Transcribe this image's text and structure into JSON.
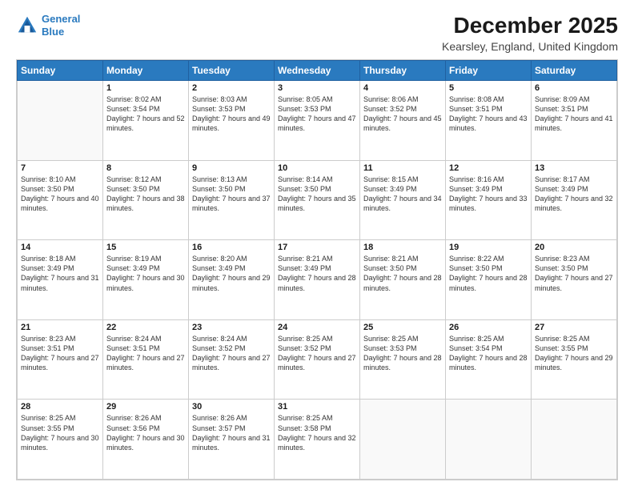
{
  "logo": {
    "line1": "General",
    "line2": "Blue"
  },
  "title": "December 2025",
  "subtitle": "Kearsley, England, United Kingdom",
  "days_of_week": [
    "Sunday",
    "Monday",
    "Tuesday",
    "Wednesday",
    "Thursday",
    "Friday",
    "Saturday"
  ],
  "weeks": [
    [
      {
        "num": "",
        "sunrise": "",
        "sunset": "",
        "daylight": "",
        "empty": true
      },
      {
        "num": "1",
        "sunrise": "Sunrise: 8:02 AM",
        "sunset": "Sunset: 3:54 PM",
        "daylight": "Daylight: 7 hours and 52 minutes."
      },
      {
        "num": "2",
        "sunrise": "Sunrise: 8:03 AM",
        "sunset": "Sunset: 3:53 PM",
        "daylight": "Daylight: 7 hours and 49 minutes."
      },
      {
        "num": "3",
        "sunrise": "Sunrise: 8:05 AM",
        "sunset": "Sunset: 3:53 PM",
        "daylight": "Daylight: 7 hours and 47 minutes."
      },
      {
        "num": "4",
        "sunrise": "Sunrise: 8:06 AM",
        "sunset": "Sunset: 3:52 PM",
        "daylight": "Daylight: 7 hours and 45 minutes."
      },
      {
        "num": "5",
        "sunrise": "Sunrise: 8:08 AM",
        "sunset": "Sunset: 3:51 PM",
        "daylight": "Daylight: 7 hours and 43 minutes."
      },
      {
        "num": "6",
        "sunrise": "Sunrise: 8:09 AM",
        "sunset": "Sunset: 3:51 PM",
        "daylight": "Daylight: 7 hours and 41 minutes."
      }
    ],
    [
      {
        "num": "7",
        "sunrise": "Sunrise: 8:10 AM",
        "sunset": "Sunset: 3:50 PM",
        "daylight": "Daylight: 7 hours and 40 minutes."
      },
      {
        "num": "8",
        "sunrise": "Sunrise: 8:12 AM",
        "sunset": "Sunset: 3:50 PM",
        "daylight": "Daylight: 7 hours and 38 minutes."
      },
      {
        "num": "9",
        "sunrise": "Sunrise: 8:13 AM",
        "sunset": "Sunset: 3:50 PM",
        "daylight": "Daylight: 7 hours and 37 minutes."
      },
      {
        "num": "10",
        "sunrise": "Sunrise: 8:14 AM",
        "sunset": "Sunset: 3:50 PM",
        "daylight": "Daylight: 7 hours and 35 minutes."
      },
      {
        "num": "11",
        "sunrise": "Sunrise: 8:15 AM",
        "sunset": "Sunset: 3:49 PM",
        "daylight": "Daylight: 7 hours and 34 minutes."
      },
      {
        "num": "12",
        "sunrise": "Sunrise: 8:16 AM",
        "sunset": "Sunset: 3:49 PM",
        "daylight": "Daylight: 7 hours and 33 minutes."
      },
      {
        "num": "13",
        "sunrise": "Sunrise: 8:17 AM",
        "sunset": "Sunset: 3:49 PM",
        "daylight": "Daylight: 7 hours and 32 minutes."
      }
    ],
    [
      {
        "num": "14",
        "sunrise": "Sunrise: 8:18 AM",
        "sunset": "Sunset: 3:49 PM",
        "daylight": "Daylight: 7 hours and 31 minutes."
      },
      {
        "num": "15",
        "sunrise": "Sunrise: 8:19 AM",
        "sunset": "Sunset: 3:49 PM",
        "daylight": "Daylight: 7 hours and 30 minutes."
      },
      {
        "num": "16",
        "sunrise": "Sunrise: 8:20 AM",
        "sunset": "Sunset: 3:49 PM",
        "daylight": "Daylight: 7 hours and 29 minutes."
      },
      {
        "num": "17",
        "sunrise": "Sunrise: 8:21 AM",
        "sunset": "Sunset: 3:49 PM",
        "daylight": "Daylight: 7 hours and 28 minutes."
      },
      {
        "num": "18",
        "sunrise": "Sunrise: 8:21 AM",
        "sunset": "Sunset: 3:50 PM",
        "daylight": "Daylight: 7 hours and 28 minutes."
      },
      {
        "num": "19",
        "sunrise": "Sunrise: 8:22 AM",
        "sunset": "Sunset: 3:50 PM",
        "daylight": "Daylight: 7 hours and 28 minutes."
      },
      {
        "num": "20",
        "sunrise": "Sunrise: 8:23 AM",
        "sunset": "Sunset: 3:50 PM",
        "daylight": "Daylight: 7 hours and 27 minutes."
      }
    ],
    [
      {
        "num": "21",
        "sunrise": "Sunrise: 8:23 AM",
        "sunset": "Sunset: 3:51 PM",
        "daylight": "Daylight: 7 hours and 27 minutes."
      },
      {
        "num": "22",
        "sunrise": "Sunrise: 8:24 AM",
        "sunset": "Sunset: 3:51 PM",
        "daylight": "Daylight: 7 hours and 27 minutes."
      },
      {
        "num": "23",
        "sunrise": "Sunrise: 8:24 AM",
        "sunset": "Sunset: 3:52 PM",
        "daylight": "Daylight: 7 hours and 27 minutes."
      },
      {
        "num": "24",
        "sunrise": "Sunrise: 8:25 AM",
        "sunset": "Sunset: 3:52 PM",
        "daylight": "Daylight: 7 hours and 27 minutes."
      },
      {
        "num": "25",
        "sunrise": "Sunrise: 8:25 AM",
        "sunset": "Sunset: 3:53 PM",
        "daylight": "Daylight: 7 hours and 28 minutes."
      },
      {
        "num": "26",
        "sunrise": "Sunrise: 8:25 AM",
        "sunset": "Sunset: 3:54 PM",
        "daylight": "Daylight: 7 hours and 28 minutes."
      },
      {
        "num": "27",
        "sunrise": "Sunrise: 8:25 AM",
        "sunset": "Sunset: 3:55 PM",
        "daylight": "Daylight: 7 hours and 29 minutes."
      }
    ],
    [
      {
        "num": "28",
        "sunrise": "Sunrise: 8:25 AM",
        "sunset": "Sunset: 3:55 PM",
        "daylight": "Daylight: 7 hours and 30 minutes."
      },
      {
        "num": "29",
        "sunrise": "Sunrise: 8:26 AM",
        "sunset": "Sunset: 3:56 PM",
        "daylight": "Daylight: 7 hours and 30 minutes."
      },
      {
        "num": "30",
        "sunrise": "Sunrise: 8:26 AM",
        "sunset": "Sunset: 3:57 PM",
        "daylight": "Daylight: 7 hours and 31 minutes."
      },
      {
        "num": "31",
        "sunrise": "Sunrise: 8:25 AM",
        "sunset": "Sunset: 3:58 PM",
        "daylight": "Daylight: 7 hours and 32 minutes."
      },
      {
        "num": "",
        "sunrise": "",
        "sunset": "",
        "daylight": "",
        "empty": true
      },
      {
        "num": "",
        "sunrise": "",
        "sunset": "",
        "daylight": "",
        "empty": true
      },
      {
        "num": "",
        "sunrise": "",
        "sunset": "",
        "daylight": "",
        "empty": true
      }
    ]
  ]
}
